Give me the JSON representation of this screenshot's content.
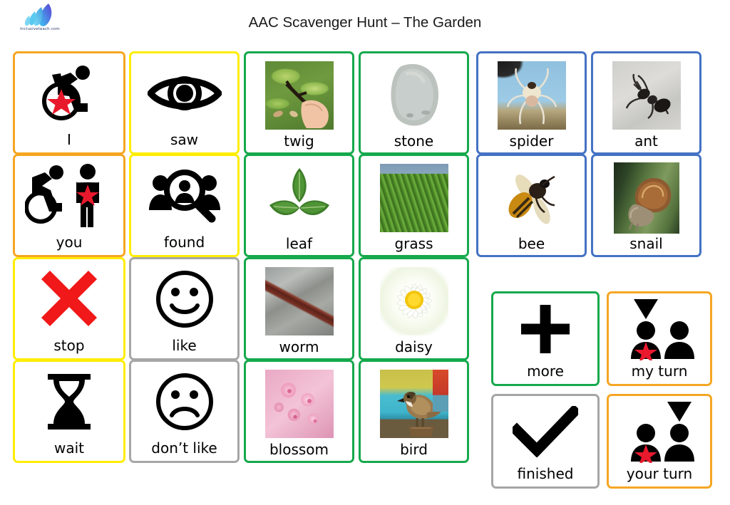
{
  "header": {
    "title": "AAC Scavenger Hunt – The Garden",
    "logo_text": "Inclusiveteach.com",
    "logo_icon": "feather-leaf-logo"
  },
  "colors": {
    "orange": "#f5a623",
    "yellow": "#ffed00",
    "green": "#15a94c",
    "blue": "#4472c4",
    "grey": "#a6a6a6",
    "red_star": "#e8192c",
    "red_cross": "#f01818"
  },
  "cards": [
    {
      "id": "i",
      "label": "I",
      "border": "orange",
      "art": "wheelchair-user-star-icon",
      "type": "symbol"
    },
    {
      "id": "saw",
      "label": "saw",
      "border": "yellow",
      "art": "eye-icon",
      "type": "symbol"
    },
    {
      "id": "twig",
      "label": "twig",
      "border": "green",
      "art": "twig-photo",
      "type": "photo"
    },
    {
      "id": "stone",
      "label": "stone",
      "border": "green",
      "art": "stone-photo",
      "type": "photo"
    },
    {
      "id": "spider",
      "label": "spider",
      "border": "blue",
      "art": "spider-photo",
      "type": "photo"
    },
    {
      "id": "ant",
      "label": "ant",
      "border": "blue",
      "art": "ant-photo",
      "type": "photo"
    },
    {
      "id": "you",
      "label": "you",
      "border": "orange",
      "art": "two-people-star-icon",
      "type": "symbol"
    },
    {
      "id": "found",
      "label": "found",
      "border": "yellow",
      "art": "people-magnifier-icon",
      "type": "symbol"
    },
    {
      "id": "leaf",
      "label": "leaf",
      "border": "green",
      "art": "leaf-photo",
      "type": "photo"
    },
    {
      "id": "grass",
      "label": "grass",
      "border": "green",
      "art": "grass-photo",
      "type": "photo"
    },
    {
      "id": "bee",
      "label": "bee",
      "border": "blue",
      "art": "bee-photo",
      "type": "photo"
    },
    {
      "id": "snail",
      "label": "snail",
      "border": "blue",
      "art": "snail-photo",
      "type": "photo"
    },
    {
      "id": "stop",
      "label": "stop",
      "border": "yellow",
      "art": "red-cross-icon",
      "type": "symbol"
    },
    {
      "id": "like",
      "label": "like",
      "border": "grey",
      "art": "happy-face-icon",
      "type": "symbol"
    },
    {
      "id": "worm",
      "label": "worm",
      "border": "green",
      "art": "worm-photo",
      "type": "photo"
    },
    {
      "id": "daisy",
      "label": "daisy",
      "border": "green",
      "art": "daisy-photo",
      "type": "photo"
    },
    {
      "id": "wait",
      "label": "wait",
      "border": "yellow",
      "art": "hourglass-icon",
      "type": "symbol"
    },
    {
      "id": "dont-like",
      "label": "don’t like",
      "border": "grey",
      "art": "sad-face-icon",
      "type": "symbol"
    },
    {
      "id": "blossom",
      "label": "blossom",
      "border": "green",
      "art": "blossom-photo",
      "type": "photo"
    },
    {
      "id": "bird",
      "label": "bird",
      "border": "green",
      "art": "bird-photo",
      "type": "photo"
    },
    {
      "id": "more",
      "label": "more",
      "border": "green",
      "art": "plus-icon",
      "type": "symbol"
    },
    {
      "id": "my-turn",
      "label": "my turn",
      "border": "orange",
      "art": "my-turn-icon",
      "type": "symbol"
    },
    {
      "id": "finished",
      "label": "finished",
      "border": "grey",
      "art": "check-icon",
      "type": "symbol"
    },
    {
      "id": "your-turn",
      "label": "your turn",
      "border": "orange",
      "art": "your-turn-icon",
      "type": "symbol"
    }
  ]
}
